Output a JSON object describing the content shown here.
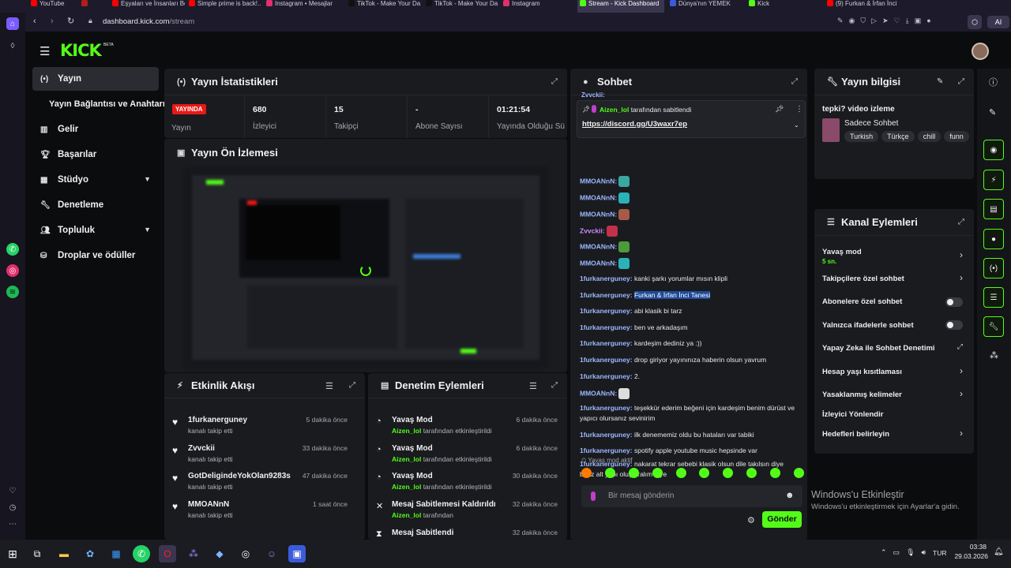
{
  "browser": {
    "tabs": [
      {
        "label": "YouTube",
        "color": "#ff0000"
      },
      {
        "label": "",
        "color": "#b71c1c"
      },
      {
        "label": "Eşyaları ve İnsanları Bo",
        "color": "#ff0000"
      },
      {
        "label": "Simple prime is back!...",
        "color": "#ff0000"
      },
      {
        "label": "Instagram • Mesajlar",
        "color": "#e1306c"
      },
      {
        "label": "TikTok - Make Your Da",
        "color": "#111111"
      },
      {
        "label": "TikTok - Make Your Da",
        "color": "#111111"
      },
      {
        "label": "Instagram",
        "color": "#e1306c"
      },
      {
        "label": "Stream - Kick Dashboard",
        "color": "#53fc18"
      },
      {
        "label": "Dünya'nın YEMEK",
        "color": "#3b5bdb"
      },
      {
        "label": "Kick",
        "color": "#53fc18"
      },
      {
        "label": "(9) Furkan & İrfan İnci",
        "color": "#ff0000"
      }
    ],
    "url_host": "dashboard.kick.com",
    "url_path": "/stream",
    "ai_label": "AI"
  },
  "nav": {
    "logo": "KICK",
    "beta": "BETA",
    "items": [
      {
        "label": "Yayın",
        "icon": "broadcast-icon"
      },
      {
        "label": "Yayın Bağlantısı ve Anahtarı",
        "icon": ""
      },
      {
        "label": "Gelir",
        "icon": "bar-chart-icon"
      },
      {
        "label": "Başarılar",
        "icon": "trophy-icon"
      },
      {
        "label": "Stüdyo",
        "icon": "grid-icon"
      },
      {
        "label": "Denetleme",
        "icon": "wrench-icon"
      },
      {
        "label": "Topluluk",
        "icon": "users-icon"
      },
      {
        "label": "Droplar ve ödüller",
        "icon": "gift-icon"
      }
    ]
  },
  "stats": {
    "title": "Yayın İstatistikleri",
    "live_badge": "YAYINDA",
    "live_label": "Yayın",
    "cells": [
      {
        "value": "680",
        "label": "İzleyici"
      },
      {
        "value": "15",
        "label": "Takipçi"
      },
      {
        "value": "-",
        "label": "Abone Sayısı"
      },
      {
        "value": "01:21:54",
        "label": "Yayında Olduğu Süre"
      }
    ]
  },
  "preview": {
    "title": "Yayın Ön İzlemesi"
  },
  "activity": {
    "title": "Etkinlik Akışı",
    "items": [
      {
        "user": "1furkanerguney",
        "action": "kanalı takip etti",
        "time": "5 dakika önce"
      },
      {
        "user": "Zvvckii",
        "action": "kanalı takip etti",
        "time": "33 dakika önce"
      },
      {
        "user": "GotDeligindeYokOlan9283s",
        "action": "kanalı takip etti",
        "time": "47 dakika önce"
      },
      {
        "user": "MMOANnN",
        "action": "kanalı takip etti",
        "time": "1 saat önce"
      }
    ]
  },
  "moderation": {
    "title": "Denetim Eylemleri",
    "items": [
      {
        "title": "Yavaş Mod",
        "by": "Aizen_lol",
        "suffix": "tarafından etkinleştirildi",
        "time": "6 dakika önce"
      },
      {
        "title": "Yavaş Mod",
        "by": "Aizen_lol",
        "suffix": "tarafından etkinleştirildi",
        "time": "6 dakika önce"
      },
      {
        "title": "Yavaş Mod",
        "by": "Aizen_lol",
        "suffix": "tarafından etkinleştirildi",
        "time": "30 dakika önce"
      },
      {
        "title": "Mesaj Sabitlemesi Kaldırıldı",
        "by": "Aizen_lol",
        "suffix": "tarafından",
        "time": "32 dakika önce"
      },
      {
        "title": "Mesaj Sabitlendi",
        "by": "",
        "suffix": "",
        "time": "32 dakika önce"
      }
    ]
  },
  "chat": {
    "title": "Sohbet",
    "pinned_by": "Aizen_lol",
    "pinned_suffix": "tarafından sabitlendi",
    "pinned_link": "https://discord.gg/U3waxr7ep",
    "clipped_user": "Zvvckii:",
    "messages": [
      {
        "user": "MMOANnN:",
        "text": "",
        "color": "#9fb7ff",
        "emote": "#3aa7a0"
      },
      {
        "user": "MMOANnN:",
        "text": "",
        "color": "#9fb7ff",
        "emote": "#2bb1b8"
      },
      {
        "user": "MMOANnN:",
        "text": "",
        "color": "#9fb7ff",
        "emote": "#a65b48"
      },
      {
        "user": "Zvvckii:",
        "text": "",
        "color": "#d08cff",
        "emote": "#c2304a"
      },
      {
        "user": "MMOANnN:",
        "text": "",
        "color": "#9fb7ff",
        "emote": "#4c9a3b"
      },
      {
        "user": "MMOANnN:",
        "text": "",
        "color": "#9fb7ff",
        "emote": "#2bb1b8"
      },
      {
        "user": "1furkanerguney:",
        "text": "kanki şarkı yorumlar mısın klipli",
        "color": "#9fb7ff",
        "emote": ""
      },
      {
        "user": "1furkanerguney:",
        "text": "Furkan & İrfan İnci Tanesi",
        "color": "#9fb7ff",
        "emote": "",
        "highlight": true
      },
      {
        "user": "1furkanerguney:",
        "text": "abi klasik bi tarz",
        "color": "#9fb7ff",
        "emote": ""
      },
      {
        "user": "1furkanerguney:",
        "text": "ben ve arkadaşım",
        "color": "#9fb7ff",
        "emote": ""
      },
      {
        "user": "1furkanerguney:",
        "text": "kardeşim dediniz ya :))",
        "color": "#9fb7ff",
        "emote": ""
      },
      {
        "user": "1furkanerguney:",
        "text": "drop giriyor yayınınıza haberin olsun yavrum",
        "color": "#9fb7ff",
        "emote": ""
      },
      {
        "user": "1furkanerguney:",
        "text": "2.",
        "color": "#9fb7ff",
        "emote": ""
      },
      {
        "user": "MMOANnN:",
        "text": "",
        "color": "#9fb7ff",
        "emote": "#dcdcdc"
      },
      {
        "user": "1furkanerguney:",
        "text": "teşekkür ederim beğeni için kardeşim benim dürüst ve yapıcı olursanız sevinirim",
        "color": "#9fb7ff",
        "emote": ""
      },
      {
        "user": "1furkanerguney:",
        "text": "ilk denememiz oldu bu hataları var tabiki",
        "color": "#9fb7ff",
        "emote": ""
      },
      {
        "user": "1furkanerguney:",
        "text": "spotify apple youtube music hepsinde var",
        "color": "#9fb7ff",
        "emote": ""
      },
      {
        "user": "1furkanerguney:",
        "text": "nakarat tekrar sebebi klasik olsun dile takılsın diye biraz alt yapı oluşturalım diye",
        "color": "#9fb7ff",
        "emote": ""
      }
    ],
    "slow_mode": "Yavaş mod aktif",
    "input_placeholder": "Bir mesaj gönderin",
    "send_label": "Gönder",
    "quick_emotes": [
      "#ff7a00",
      "#53fc18",
      "#53fc18",
      "#53fc18",
      "#53fc18",
      "#53fc18",
      "#53fc18",
      "#53fc18",
      "#53fc18",
      "#53fc18"
    ]
  },
  "stream_info": {
    "title": "Yayın bilgisi",
    "stream_title": "tepki? video izleme",
    "category": "Sadece Sohbet",
    "tags": [
      "Turkish",
      "Türkçe",
      "chill",
      "funn"
    ]
  },
  "channel_actions": {
    "title": "Kanal Eylemleri",
    "items": [
      {
        "label": "Yavaş mod",
        "sub": "5 sn.",
        "control": "arrow"
      },
      {
        "label": "Takipçilere özel sohbet",
        "sub": "",
        "control": "arrow"
      },
      {
        "label": "Abonelere özel sohbet",
        "sub": "",
        "control": "toggle"
      },
      {
        "label": "Yalnızca ifadelerle sohbet",
        "sub": "",
        "control": "toggle"
      },
      {
        "label": "Yapay Zeka ile Sohbet Denetimi",
        "sub": "",
        "control": "external"
      },
      {
        "label": "Hesap yaşı kısıtlaması",
        "sub": "",
        "control": "arrow"
      },
      {
        "label": "Yasaklanmış kelimeler",
        "sub": "",
        "control": "arrow"
      },
      {
        "label": "İzleyici Yönlendir",
        "sub": "",
        "control": ""
      },
      {
        "label": "Hedefleri belirleyin",
        "sub": "",
        "control": "arrow"
      }
    ]
  },
  "watermark": {
    "line1": "Windows'u Etkinleştir",
    "line2": "Windows'u etkinleştirmek için Ayarlar'a gidin."
  },
  "taskbar": {
    "lang": "TUR",
    "time": "03:38",
    "date": "29.03.2026"
  },
  "colors": {
    "accent": "#53fc18",
    "live": "#e91916"
  }
}
